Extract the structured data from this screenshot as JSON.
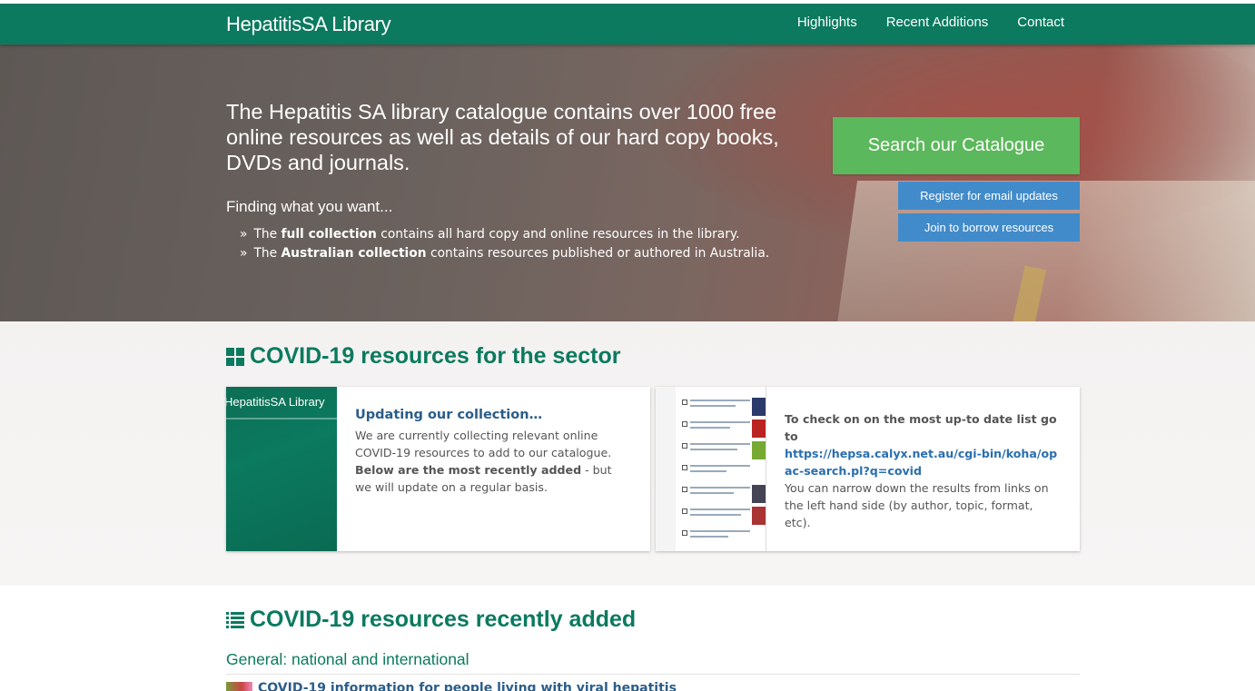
{
  "header": {
    "brand": "HepatitisSA Library",
    "nav": [
      "Highlights",
      "Recent Additions",
      "Contact"
    ]
  },
  "hero": {
    "intro": "The Hepatitis SA library catalogue contains over 1000 free online resources as well as details of our hard copy books, DVDs and journals.",
    "finding_title": "Finding what you want...",
    "list": [
      {
        "prefix": "The ",
        "bold": "full collection",
        "suffix": " contains all hard copy and online resources in the library."
      },
      {
        "prefix": "The ",
        "bold": "Australian collection",
        "suffix": " contains resources published or authored in Australia."
      }
    ],
    "search_button": "Search our Catalogue",
    "register_button": "Register for email updates",
    "join_button": "Join to borrow resources"
  },
  "covid_sector": {
    "title": "COVID-19 resources for the sector",
    "card1": {
      "thumb_brand": "HepatitisSA Library",
      "heading": "Updating our collection…",
      "text1": "We are currently collecting relevant online COVID-19 resources to add to our catalogue. ",
      "bold": "Below are the most recently added",
      "text2": " - but we will update on a regular basis."
    },
    "card2": {
      "lead": "To check on on the most up-to date list go to",
      "link": "https://hepsa.calyx.net.au/cgi-bin/koha/opac-search.pl?q=covid",
      "text": "You can narrow down the results from links on the left hand side (by author, topic, format, etc)."
    }
  },
  "covid_recent": {
    "title": "COVID-19 resources recently added",
    "subhead": "General: national and international",
    "first_item": "COVID-19 information for people living with viral hepatitis"
  },
  "colors": {
    "brand_green": "#0b7a5f",
    "search_green": "#5cb85c",
    "button_blue": "#428bca"
  }
}
